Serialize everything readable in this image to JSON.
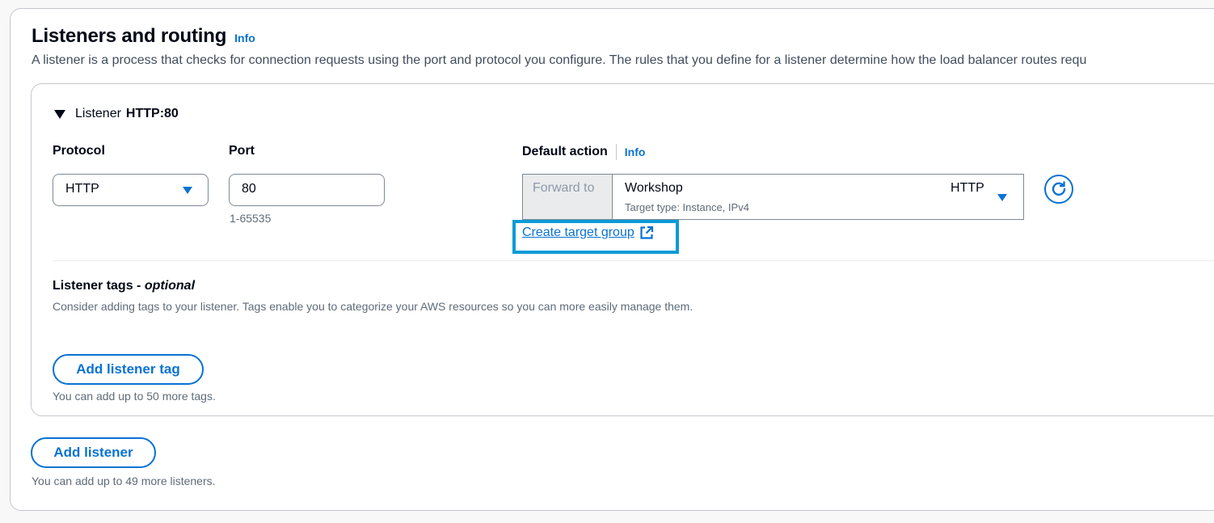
{
  "section": {
    "title": "Listeners and routing",
    "info_label": "Info",
    "description": "A listener is a process that checks for connection requests using the port and protocol you configure. The rules that you define for a listener determine how the load balancer routes requ"
  },
  "listener": {
    "header_label": "Listener",
    "header_value": "HTTP:80",
    "protocol": {
      "label": "Protocol",
      "value": "HTTP"
    },
    "port": {
      "label": "Port",
      "value": "80",
      "hint": "1-65535"
    },
    "default_action": {
      "label": "Default action",
      "info_label": "Info",
      "prefix": "Forward to",
      "target_name": "Workshop",
      "target_type": "Target type: Instance, IPv4",
      "target_protocol": "HTTP",
      "create_link": "Create target group"
    },
    "tags": {
      "title": "Listener tags -",
      "title_optional": "optional",
      "description": "Consider adding tags to your listener. Tags enable you to categorize your AWS resources so you can more easily manage them.",
      "add_button": "Add listener tag",
      "limit_hint": "You can add up to 50 more tags."
    }
  },
  "add_listener": {
    "button": "Add listener",
    "limit_hint": "You can add up to 49 more listeners."
  },
  "colors": {
    "accent": "#0972d3",
    "highlight_frame": "#0a9bd6"
  }
}
